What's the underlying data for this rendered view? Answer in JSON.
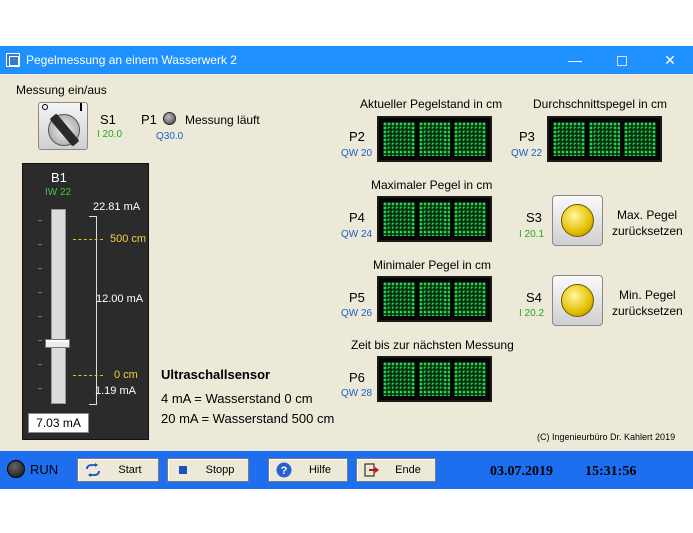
{
  "window": {
    "title": "Pegelmessung an einem Wasserwerk 2"
  },
  "switch_s1": {
    "section_label": "Messung ein/aus",
    "name": "S1",
    "address": "I 20.0"
  },
  "lamp_p1": {
    "name": "P1",
    "label": "Messung läuft",
    "address": "Q30.0"
  },
  "gauge_b1": {
    "name": "B1",
    "address": "IW 22",
    "max_label": "22.81 mA",
    "mark_high": "500 cm",
    "mid_label": "12.00 mA",
    "mark_low": "0 cm",
    "min_label": "1.19 mA",
    "value": "7.03 mA",
    "slider_fraction": 0.3
  },
  "sensor_info": {
    "title": "Ultraschallsensor",
    "line1": "4 mA = Wasserstand 0 cm",
    "line2": "20 mA = Wasserstand 500 cm"
  },
  "displays": {
    "p2": {
      "caption": "Aktueller Pegelstand in cm",
      "name": "P2",
      "address": "QW 20"
    },
    "p3": {
      "caption": "Durchschnittspegel in cm",
      "name": "P3",
      "address": "QW 22"
    },
    "p4": {
      "caption": "Maximaler Pegel in cm",
      "name": "P4",
      "address": "QW 24"
    },
    "p5": {
      "caption": "Minimaler Pegel in cm",
      "name": "P5",
      "address": "QW 26"
    },
    "p6": {
      "caption": "Zeit bis zur nächsten Messung",
      "name": "P6",
      "address": "QW 28"
    }
  },
  "buttons": {
    "s3": {
      "name": "S3",
      "address": "I 20.1",
      "label_line1": "Max. Pegel",
      "label_line2": "zurücksetzen"
    },
    "s4": {
      "name": "S4",
      "address": "I 20.2",
      "label_line1": "Min. Pegel",
      "label_line2": "zurücksetzen"
    }
  },
  "copyright": "(C) Ingenieurbüro Dr. Kahlert 2019",
  "footer": {
    "run_label": "RUN",
    "start_label": "Start",
    "stop_label": "Stopp",
    "help_label": "Hilfe",
    "end_label": "Ende",
    "date": "03.07.2019",
    "time": "15:31:56"
  },
  "colors": {
    "titlebar": "#1e90ff",
    "panel": "#ece9d8",
    "footer": "#1e6ff0",
    "display_led": "#22d84a",
    "address_green": "#22a822",
    "address_blue": "#2060c0"
  }
}
